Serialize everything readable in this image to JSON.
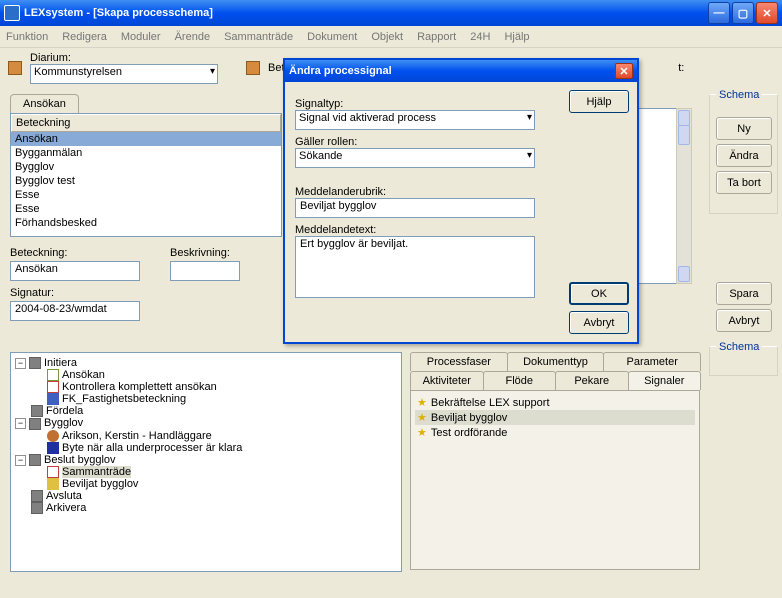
{
  "window": {
    "title": "LEXsystem - [Skapa processchema]"
  },
  "menu": [
    "Funktion",
    "Redigera",
    "Moduler",
    "Ärende",
    "Sammanträde",
    "Dokument",
    "Objekt",
    "Rapport",
    "24H",
    "Hjälp"
  ],
  "toolbar": {
    "diarium_label": "Diarium:",
    "diarium_value": "Kommunstyrelsen",
    "beteckn_label": "Beteckni",
    "trailing": "t:"
  },
  "tab_ansokan": "Ansökan",
  "list_header": "Beteckning",
  "list_items": [
    "Ansökan",
    "Bygganmälan",
    "Bygglov",
    "Bygglov test",
    "Esse",
    "Esse",
    "Förhandsbesked"
  ],
  "fields": {
    "beteckning_label": "Beteckning:",
    "beteckning_value": "Ansökan",
    "beskrivning_label": "Beskrivning:",
    "signatur_label": "Signatur:",
    "signatur_value": "2004-08-23/wmdat"
  },
  "dialog": {
    "title": "Ändra processignal",
    "hjalp": "Hjälp",
    "signaltyp_label": "Signaltyp:",
    "signaltyp_value": "Signal vid aktiverad process",
    "galler_label": "Gäller rollen:",
    "galler_value": "Sökande",
    "rubrik_label": "Meddelanderubrik:",
    "rubrik_value": "Beviljat bygglov",
    "text_label": "Meddelandetext:",
    "text_value": "Ert bygglov är beviljat.",
    "ok": "OK",
    "avbryt": "Avbryt"
  },
  "tree": {
    "initiera": "Initiera",
    "ansokan": "Ansökan",
    "kontrollera": "Kontrollera komplettett ansökan",
    "fk": "FK_Fastighetsbeteckning",
    "fordela": "Fördela",
    "bygglov": "Bygglov",
    "arikson": "Arikson, Kerstin - Handläggare",
    "byte": "Byte när alla underprocesser är klara",
    "beslut": "Beslut bygglov",
    "sammantrade": "Sammanträde",
    "beviljat": "Beviljat bygglov",
    "avsluta": "Avsluta",
    "arkivera": "Arkivera"
  },
  "tabs1": [
    "Processfaser",
    "Dokumenttyp",
    "Parameter"
  ],
  "tabs2": [
    "Aktiviteter",
    "Flöde",
    "Pekare",
    "Signaler"
  ],
  "signals": [
    "Bekräftelse LEX support",
    "Beviljat bygglov",
    "Test ordförande"
  ],
  "rightbtns": {
    "schema1": "Schema",
    "ny": "Ny",
    "andra": "Ändra",
    "tabort": "Ta bort",
    "spara": "Spara",
    "avbryt": "Avbryt",
    "schema2": "Schema"
  }
}
